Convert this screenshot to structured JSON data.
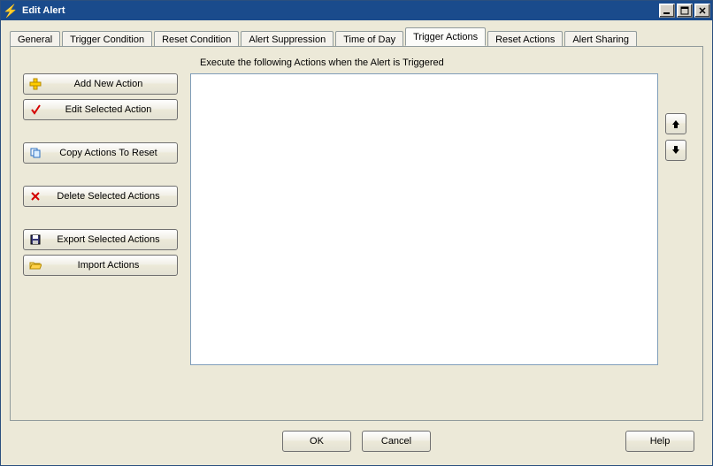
{
  "window": {
    "title": "Edit Alert"
  },
  "tabs": [
    {
      "label": "General"
    },
    {
      "label": "Trigger Condition"
    },
    {
      "label": "Reset Condition"
    },
    {
      "label": "Alert Suppression"
    },
    {
      "label": "Time of Day"
    },
    {
      "label": "Trigger Actions",
      "active": true
    },
    {
      "label": "Reset Actions"
    },
    {
      "label": "Alert Sharing"
    }
  ],
  "hint": "Execute the following Actions when the Alert is Triggered",
  "side_buttons": {
    "add": "Add New Action",
    "edit": "Edit Selected Action",
    "copy": "Copy Actions To Reset",
    "delete": "Delete Selected Actions",
    "export": "Export Selected Actions",
    "import": "Import Actions"
  },
  "footer": {
    "ok": "OK",
    "cancel": "Cancel",
    "help": "Help"
  }
}
